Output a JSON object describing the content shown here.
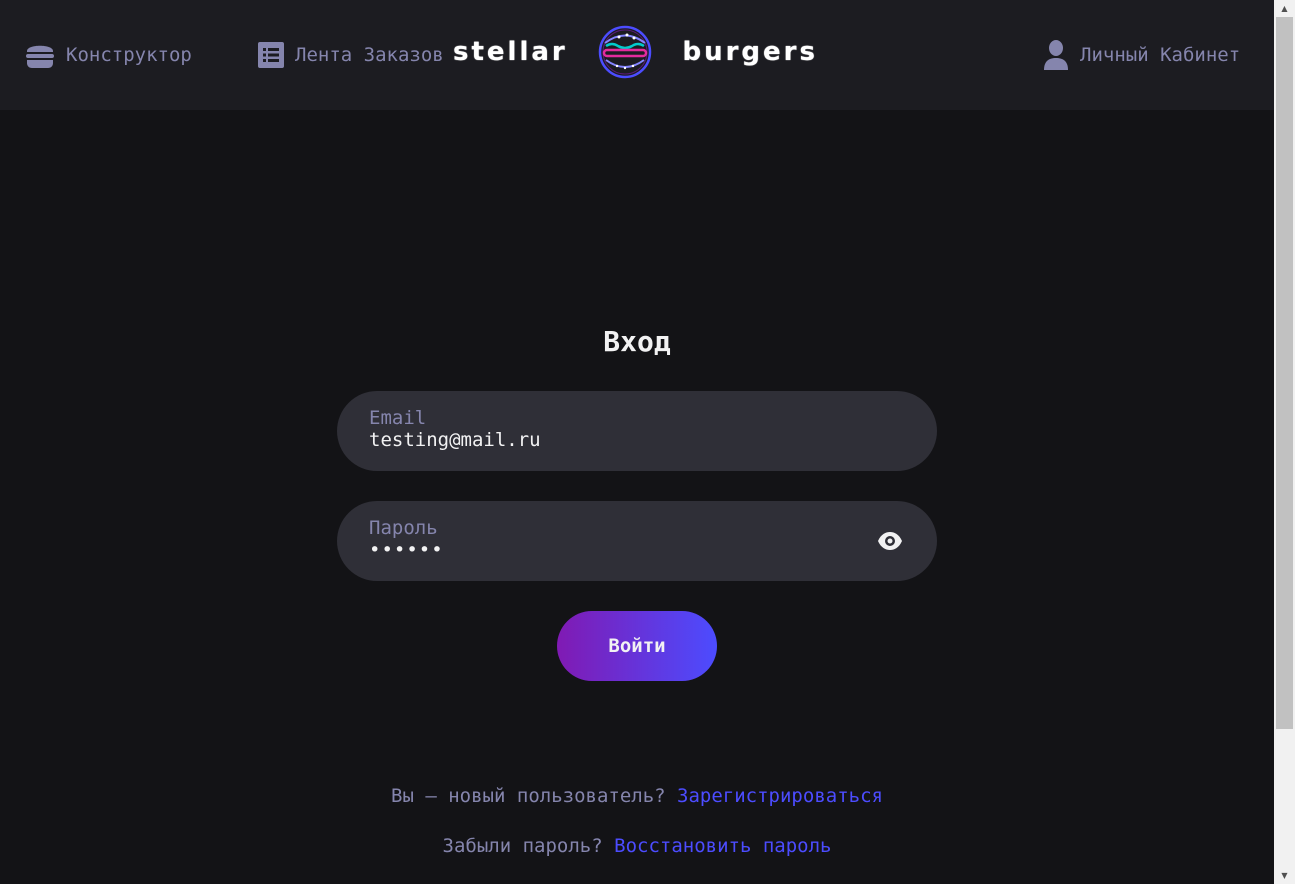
{
  "header": {
    "nav": {
      "constructor_label": "Конструктор",
      "feed_label": "Лента Заказов",
      "profile_label": "Личный Кабинет"
    },
    "logo": {
      "left_word": "stellar",
      "right_word": "burgers"
    }
  },
  "login": {
    "title": "Вход",
    "email": {
      "label": "Email",
      "value": "testing@mail.ru"
    },
    "password": {
      "label": "Пароль",
      "value": "••••••"
    },
    "submit_label": "Войти"
  },
  "footer_links": {
    "register_text": "Вы — новый пользователь?",
    "register_link": "Зарегистрироваться",
    "restore_text": "Забыли пароль?",
    "restore_link": "Восстановить пароль"
  },
  "icons": {
    "constructor": "burger-icon",
    "feed": "list-icon",
    "profile": "profile-icon",
    "password_toggle": "eye-icon"
  },
  "colors": {
    "background": "#131316",
    "header": "#1C1C21",
    "input": "#2F2F37",
    "inactive_text": "#8585AD",
    "accent": "#4C4CFF",
    "button_gradient_start": "#801AB3",
    "button_gradient_end": "#4C4CFF"
  }
}
